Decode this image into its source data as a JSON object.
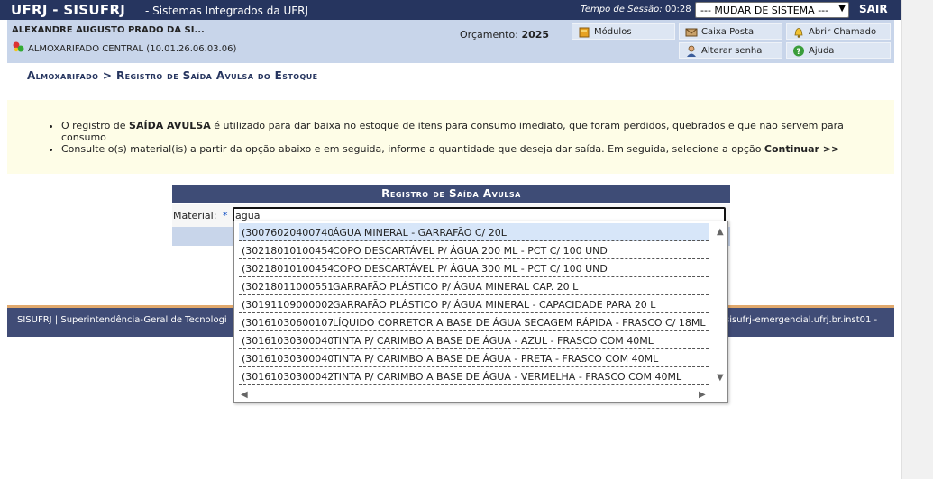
{
  "header": {
    "app_title": "UFRJ - SISUFRJ",
    "subtitle": "- Sistemas Integrados da UFRJ",
    "session_label": "Tempo de Sessão:",
    "session_time": "00:28",
    "system_select": "--- MUDAR DE SISTEMA ---",
    "exit_label": "SAIR"
  },
  "user": {
    "name": "ALEXANDRE AUGUSTO PRADO DA SI...",
    "unit": "ALMOXARIFADO CENTRAL (10.01.26.06.03.06)",
    "budget_label": "Orçamento:",
    "budget_year": "2025"
  },
  "menu": {
    "modules": "Módulos",
    "mailbox": "Caixa Postal",
    "open_ticket": "Abrir Chamado",
    "change_password": "Alterar senha",
    "help": "Ajuda"
  },
  "breadcrumb": "Almoxarifado > Registro de Saída Avulsa do Estoque",
  "info": {
    "line1_prefix": "O registro de ",
    "line1_bold": "SAÍDA AVULSA",
    "line1_suffix": " é utilizado para dar baixa no estoque de itens para consumo imediato, que foram perdidos, quebrados e que não servem para consumo",
    "line2_prefix": "Consulte o(s) material(is) a partir da opção abaixo e em seguida, informe a quantidade que deseja dar saída. Em seguida, selecione a opção ",
    "line2_bold": "Continuar >>"
  },
  "form": {
    "title": "Registro de Saída Avulsa",
    "material_label": "Material:",
    "required_mark": "*",
    "material_value": "agua"
  },
  "footer": {
    "left": "SISUFRJ | Superintendência-Geral de Tecnologi",
    "right": "sisufrj-emergencial.ufrj.br.inst01 -"
  },
  "autocomplete": {
    "items": [
      {
        "code": "(300760204007405)",
        "desc": "ÁGUA MINERAL - GARRAFÃO C/ 20L"
      },
      {
        "code": "(302180101004544)",
        "desc": "COPO DESCARTÁVEL P/ ÁGUA 200 ML - PCT C/ 100 UND"
      },
      {
        "code": "(302180101004545)",
        "desc": "COPO DESCARTÁVEL P/ ÁGUA 300 ML - PCT C/ 100 UND"
      },
      {
        "code": "(302180110005516)",
        "desc": "GARRAFÃO PLÁSTICO P/ ÁGUA MINERAL CAP. 20 L"
      },
      {
        "code": "(301911090000026)",
        "desc": "GARRAFÃO PLÁSTICO P/ ÁGUA MINERAL - CAPACIDADE PARA 20 L"
      },
      {
        "code": "(301610306001071)",
        "desc": "LÍQUIDO CORRETOR A BASE DE ÁGUA SECAGEM RÁPIDA - FRASCO C/ 18ML"
      },
      {
        "code": "(301610303000407)",
        "desc": "TINTA P/ CARIMBO A BASE DE ÁGUA - AZUL - FRASCO COM 40ML"
      },
      {
        "code": "(301610303000408)",
        "desc": "TINTA P/ CARIMBO A BASE DE ÁGUA - PRETA - FRASCO COM 40ML"
      },
      {
        "code": "(301610303000420)",
        "desc": "TINTA P/ CARIMBO A BASE DE ÁGUA - VERMELHA - FRASCO COM 40ML"
      }
    ]
  },
  "colors": {
    "topbar": "#26355f",
    "userarea": "#c8d5ea",
    "form_title": "#3e4c76",
    "footer_border": "#e1a96d",
    "info_bg": "#fefde7"
  }
}
